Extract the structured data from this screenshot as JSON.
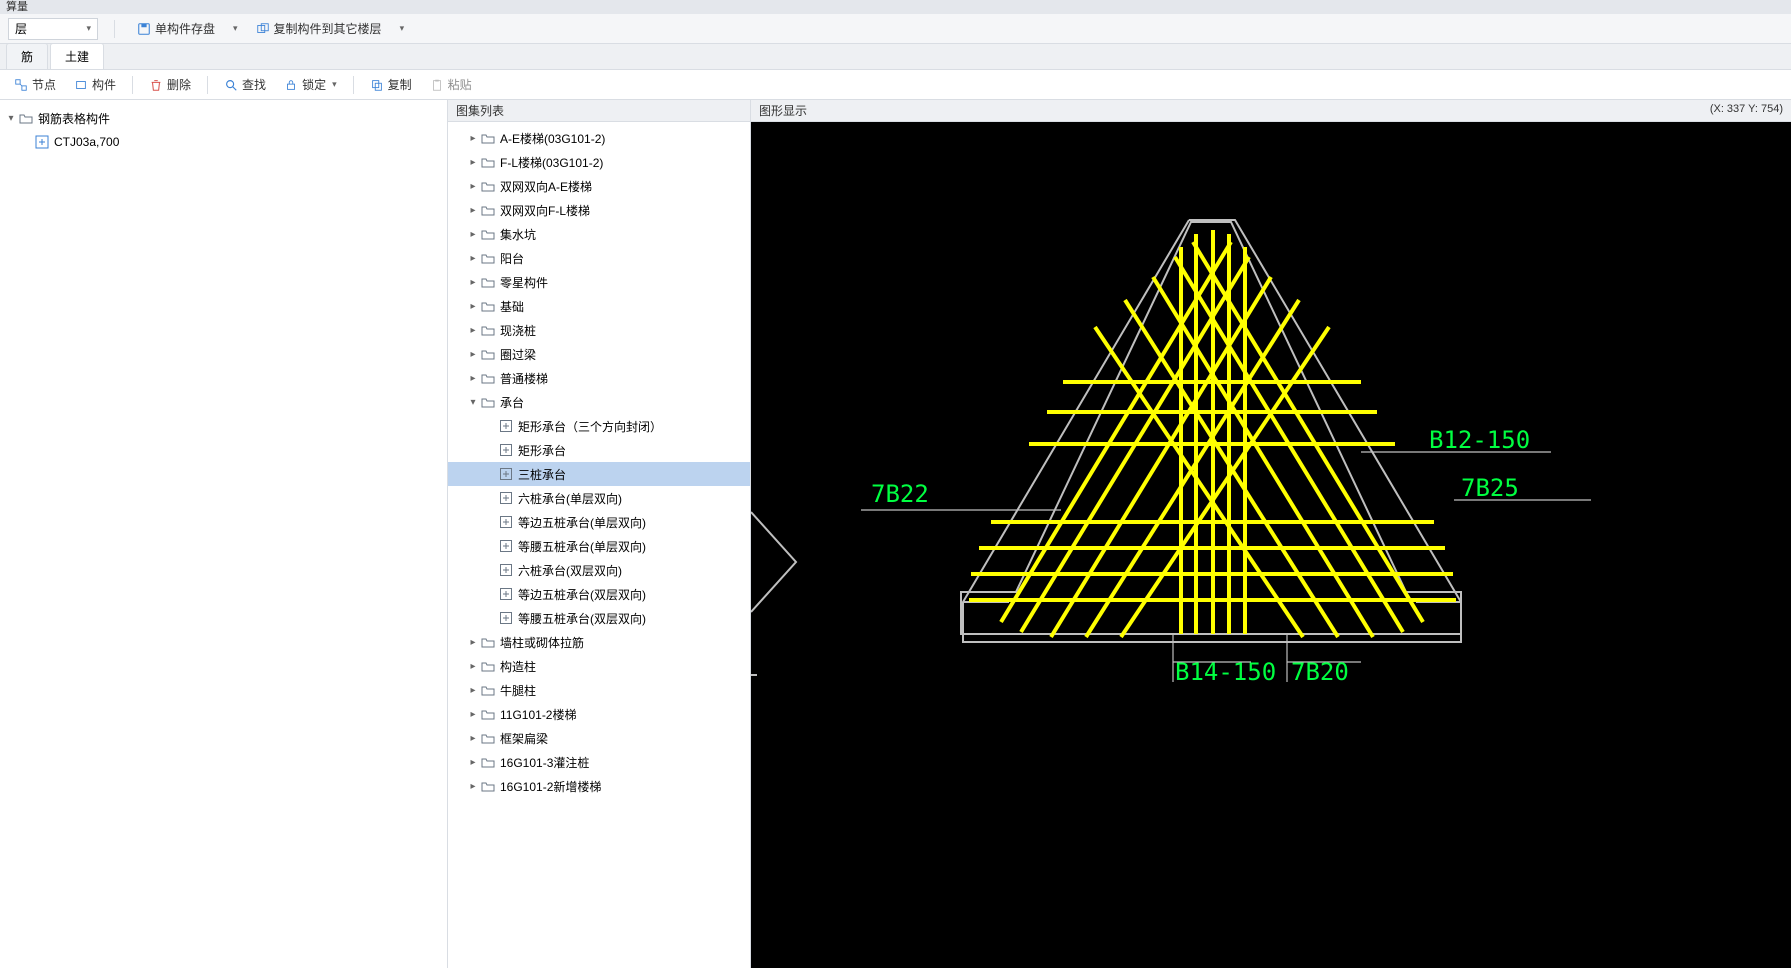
{
  "titlebar": "算量",
  "toolbar1": {
    "combo_label": "层",
    "save_label": "单构件存盘",
    "copy_label": "复制构件到其它楼层"
  },
  "tabs": {
    "t0": "筋",
    "t1": "土建"
  },
  "actions": {
    "node": "节点",
    "member": "构件",
    "del": "删除",
    "find": "查找",
    "lock": "锁定",
    "copy": "复制",
    "paste": "粘贴"
  },
  "left_tree": {
    "root": "钢筋表格构件",
    "child": "CTJ03a,700"
  },
  "mid_header": "图集列表",
  "mid_tree": [
    {
      "l": "A-E楼梯(03G101-2)",
      "d": 1,
      "t": "f",
      "e": 0
    },
    {
      "l": "F-L楼梯(03G101-2)",
      "d": 1,
      "t": "f",
      "e": 0
    },
    {
      "l": "双网双向A-E楼梯",
      "d": 1,
      "t": "f",
      "e": 0
    },
    {
      "l": "双网双向F-L楼梯",
      "d": 1,
      "t": "f",
      "e": 0
    },
    {
      "l": "集水坑",
      "d": 1,
      "t": "f",
      "e": 0
    },
    {
      "l": "阳台",
      "d": 1,
      "t": "f",
      "e": 0
    },
    {
      "l": "零星构件",
      "d": 1,
      "t": "f",
      "e": 0
    },
    {
      "l": "基础",
      "d": 1,
      "t": "f",
      "e": 0
    },
    {
      "l": "现浇桩",
      "d": 1,
      "t": "f",
      "e": 0
    },
    {
      "l": "圈过梁",
      "d": 1,
      "t": "f",
      "e": 0
    },
    {
      "l": "普通楼梯",
      "d": 1,
      "t": "f",
      "e": 0
    },
    {
      "l": "承台",
      "d": 1,
      "t": "f",
      "e": 1
    },
    {
      "l": "矩形承台（三个方向封闭）",
      "d": 2,
      "t": "i",
      "e": 0
    },
    {
      "l": "矩形承台",
      "d": 2,
      "t": "i",
      "e": 0
    },
    {
      "l": "三桩承台",
      "d": 2,
      "t": "i",
      "e": 0,
      "sel": 1
    },
    {
      "l": "六桩承台(单层双向)",
      "d": 2,
      "t": "i",
      "e": 0
    },
    {
      "l": "等边五桩承台(单层双向)",
      "d": 2,
      "t": "i",
      "e": 0
    },
    {
      "l": "等腰五桩承台(单层双向)",
      "d": 2,
      "t": "i",
      "e": 0
    },
    {
      "l": "六桩承台(双层双向)",
      "d": 2,
      "t": "i",
      "e": 0
    },
    {
      "l": "等边五桩承台(双层双向)",
      "d": 2,
      "t": "i",
      "e": 0
    },
    {
      "l": "等腰五桩承台(双层双向)",
      "d": 2,
      "t": "i",
      "e": 0
    },
    {
      "l": "墙柱或砌体拉筋",
      "d": 1,
      "t": "f",
      "e": 0
    },
    {
      "l": "构造柱",
      "d": 1,
      "t": "f",
      "e": 0
    },
    {
      "l": "牛腿柱",
      "d": 1,
      "t": "f",
      "e": 0
    },
    {
      "l": "11G101-2楼梯",
      "d": 1,
      "t": "f",
      "e": 0
    },
    {
      "l": "框架扁梁",
      "d": 1,
      "t": "f",
      "e": 0
    },
    {
      "l": "16G101-3灌注桩",
      "d": 1,
      "t": "f",
      "e": 0
    },
    {
      "l": "16G101-2新增楼梯",
      "d": 1,
      "t": "f",
      "e": 0
    }
  ],
  "right_header": "图形显示",
  "coord": "(X: 337 Y: 754)",
  "annot": {
    "a1": "7B22",
    "a2": "B12-150",
    "a3": "7B25",
    "a4": "B14-150",
    "a5": "7B20"
  }
}
